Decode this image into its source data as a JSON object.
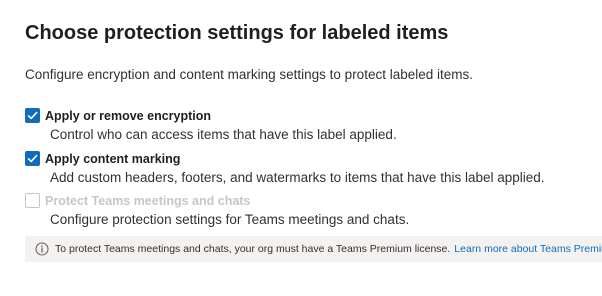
{
  "page": {
    "title": "Choose protection settings for labeled items",
    "description": "Configure encryption and content marking settings to protect labeled items."
  },
  "options": [
    {
      "label": "Apply or remove encryption",
      "description": "Control who can access items that have this label applied.",
      "checked": true,
      "disabled": false
    },
    {
      "label": "Apply content marking",
      "description": "Add custom headers, footers, and watermarks to items that have this label applied.",
      "checked": true,
      "disabled": false
    },
    {
      "label": "Protect Teams meetings and chats",
      "description": "Configure protection settings for Teams meetings and chats.",
      "checked": false,
      "disabled": true
    }
  ],
  "info_bar": {
    "icon": "info-icon",
    "text": "To protect Teams meetings and chats, your org must have a Teams Premium license.",
    "link_text": "Learn more about Teams Premium"
  },
  "colors": {
    "accent": "#0f6cbd",
    "disabled": "#c8c6c4",
    "info_background": "#f3f2f1"
  }
}
